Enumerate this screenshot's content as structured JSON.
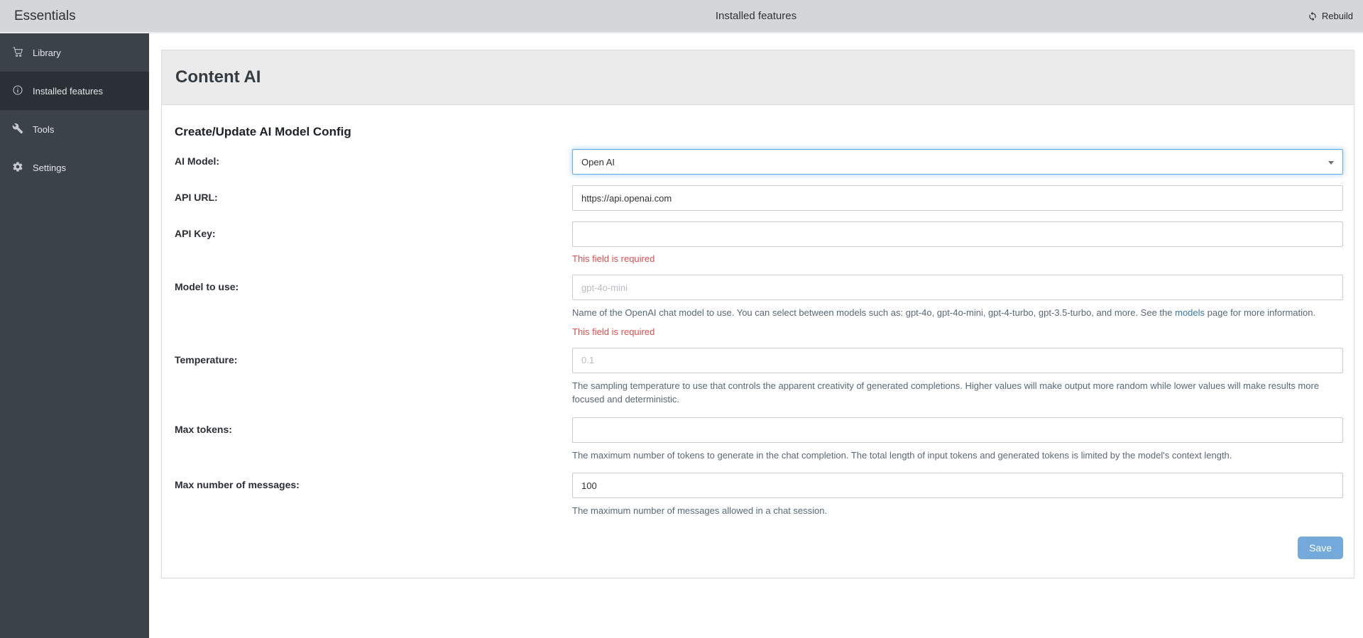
{
  "navbar": {
    "brand": "Essentials",
    "title": "Installed features",
    "rebuild_label": "Rebuild"
  },
  "sidebar": {
    "items": [
      {
        "label": "Library",
        "icon": "cart-icon",
        "active": false
      },
      {
        "label": "Installed features",
        "icon": "info-circle-icon",
        "active": true
      },
      {
        "label": "Tools",
        "icon": "wrench-icon",
        "active": false
      },
      {
        "label": "Settings",
        "icon": "gear-icon",
        "active": false
      }
    ]
  },
  "panel": {
    "title": "Content AI"
  },
  "form": {
    "heading": "Create/Update AI Model Config",
    "fields": [
      {
        "label": "AI Model:",
        "value": "Open AI"
      },
      {
        "label": "API URL:",
        "value": "https://api.openai.com"
      },
      {
        "label": "API Key:",
        "value": "",
        "error": "This field is required"
      },
      {
        "label": "Model to use:",
        "placeholder": "gpt-4o-mini",
        "help_before": "Name of the OpenAI chat model to use. You can select between models such as: gpt-4o, gpt-4o-mini, gpt-4-turbo, gpt-3.5-turbo, and more. See the ",
        "help_link": "models",
        "help_after": " page for more information.",
        "error": "This field is required"
      },
      {
        "label": "Temperature:",
        "placeholder": "0.1",
        "help": "The sampling temperature to use that controls the apparent creativity of generated completions. Higher values will make output more random while lower values will make results more focused and deterministic."
      },
      {
        "label": "Max tokens:",
        "value": "",
        "help": "The maximum number of tokens to generate in the chat completion. The total length of input tokens and generated tokens is limited by the model's context length."
      },
      {
        "label": "Max number of messages:",
        "value": "100",
        "help": "The maximum number of messages allowed in a chat session."
      }
    ],
    "save_label": "Save"
  },
  "colors": {
    "navbar_bg": "#d5d6d8",
    "sidebar_bg": "#3b424a",
    "sidebar_active_bg": "#2a3036",
    "panel_heading_bg": "#ebebeb",
    "focus_border": "#66afe9",
    "error_red": "#e04f4f",
    "link_blue": "#3879b5",
    "save_button_bg": "#74aadb"
  }
}
